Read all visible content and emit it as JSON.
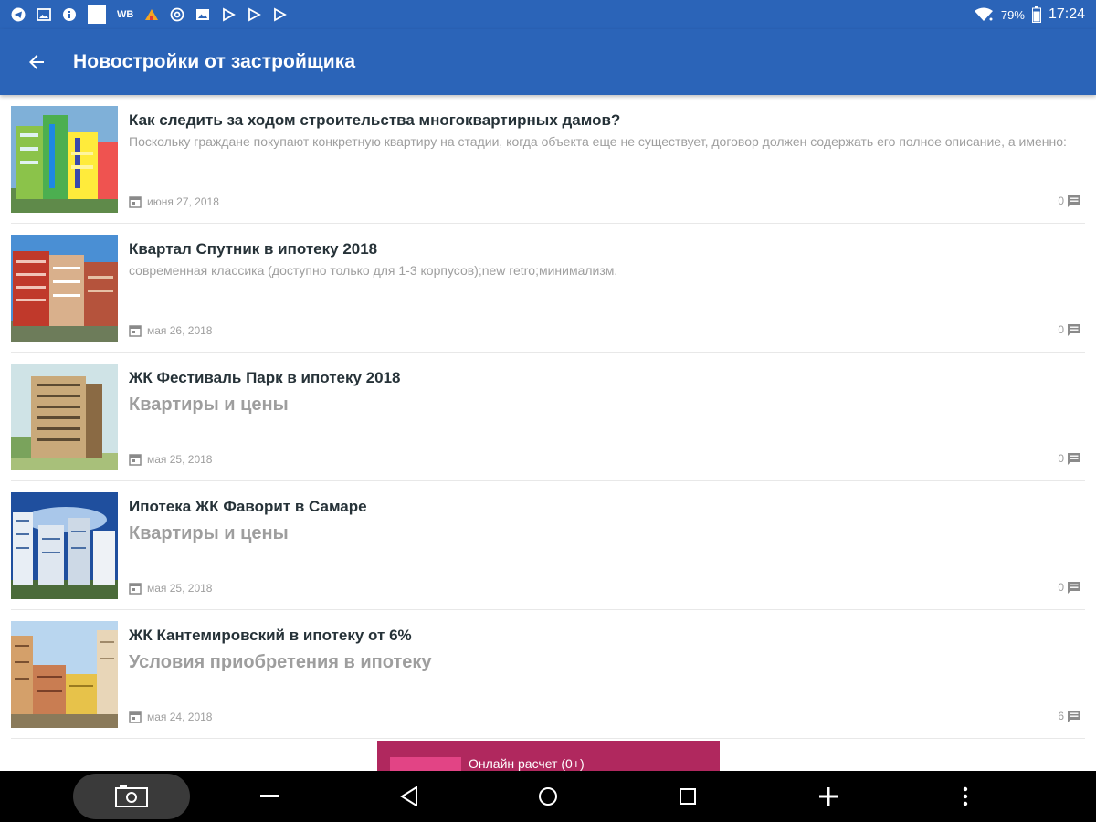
{
  "status_bar": {
    "icons": [
      "telegram-icon",
      "image-icon",
      "info-icon",
      "white-square-icon",
      "wb-icon",
      "warning-icon",
      "at-icon",
      "gallery-icon",
      "play-store-icon",
      "play-store-icon",
      "play-store-icon"
    ],
    "wb_label": "WB",
    "battery": "79%",
    "time": "17:24"
  },
  "app_bar": {
    "title": "Новостройки от застройщика",
    "back_icon": "arrow-back-icon"
  },
  "news": [
    {
      "title": "Как следить за ходом строительства многоквартирных дамов?",
      "description": "Поскольку граждане покупают конкретную квартиру на стадии, когда объекта еще не существует, договор должен содержать его полное описание, а именно:",
      "description_style": "small",
      "date": "июня 27, 2018",
      "comments": "0"
    },
    {
      "title": "Квартал Спутник в ипотеку 2018",
      "description": "современная классика (доступно только для 1-3 корпусов);new retro;минимализм.",
      "description_style": "small",
      "date": "мая 26, 2018",
      "comments": "0"
    },
    {
      "title": "ЖК Фестиваль Парк в ипотеку 2018",
      "description": "Квартиры и цены",
      "description_style": "big",
      "date": "мая 25, 2018",
      "comments": "0"
    },
    {
      "title": "Ипотека ЖК Фаворит в Самаре",
      "description": "Квартиры и цены",
      "description_style": "big",
      "date": "мая 25, 2018",
      "comments": "0"
    },
    {
      "title": "ЖК Кантемировский в ипотеку от 6%",
      "description": "Условия приобретения в ипотеку",
      "description_style": "big",
      "date": "мая 24, 2018",
      "comments": "6"
    }
  ],
  "calc_button": {
    "label": "Онлайн расчет (0+)"
  },
  "nav_bar": {
    "buttons": [
      "screenshot-icon",
      "volume-down-icon",
      "back-icon",
      "home-icon",
      "recents-icon",
      "volume-up-icon",
      "more-icon"
    ]
  },
  "colors": {
    "primary": "#2b64b8",
    "accent": "#b0285e",
    "accent_light": "#e24485"
  }
}
